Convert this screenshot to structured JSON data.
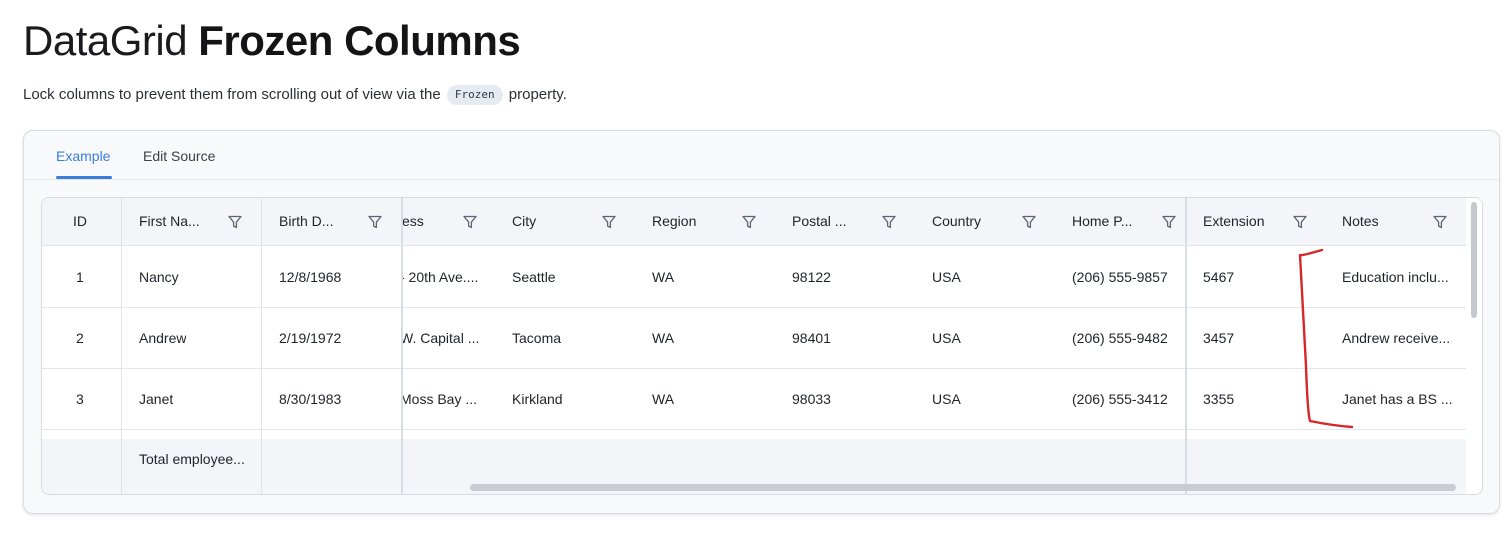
{
  "title": {
    "light": "DataGrid",
    "bold": "Frozen Columns"
  },
  "description": {
    "before": "Lock columns to prevent them from scrolling out of view via the",
    "code": "Frozen",
    "after": "property."
  },
  "tabs": [
    {
      "label": "Example",
      "active": true
    },
    {
      "label": "Edit Source",
      "active": false
    }
  ],
  "columns": {
    "id": "ID",
    "first_name": "First Na...",
    "birth_date": "Birth D...",
    "address": "ess",
    "city": "City",
    "region": "Region",
    "postal": "Postal ...",
    "country": "Country",
    "home_phone": "Home P...",
    "extension": "Extension",
    "notes": "Notes"
  },
  "rows": [
    {
      "id": "1",
      "first_name": "Nancy",
      "birth_date": "12/8/1968",
      "address": "- 20th Ave....",
      "city": "Seattle",
      "region": "WA",
      "postal": "98122",
      "country": "USA",
      "home_phone": "(206) 555-9857",
      "extension": "5467",
      "notes": "Education inclu..."
    },
    {
      "id": "2",
      "first_name": "Andrew",
      "birth_date": "2/19/1972",
      "address": "W. Capital ...",
      "city": "Tacoma",
      "region": "WA",
      "postal": "98401",
      "country": "USA",
      "home_phone": "(206) 555-9482",
      "extension": "3457",
      "notes": "Andrew receive..."
    },
    {
      "id": "3",
      "first_name": "Janet",
      "birth_date": "8/30/1983",
      "address": "Moss Bay ...",
      "city": "Kirkland",
      "region": "WA",
      "postal": "98033",
      "country": "USA",
      "home_phone": "(206) 555-3412",
      "extension": "3355",
      "notes": "Janet has a BS ..."
    }
  ],
  "footer": {
    "first_name": "Total employee..."
  },
  "icons": {
    "filter": "filter-icon"
  },
  "colors": {
    "accent": "#3b7ddd",
    "annotation": "#d62828",
    "header_bg": "#f3f5f8"
  }
}
